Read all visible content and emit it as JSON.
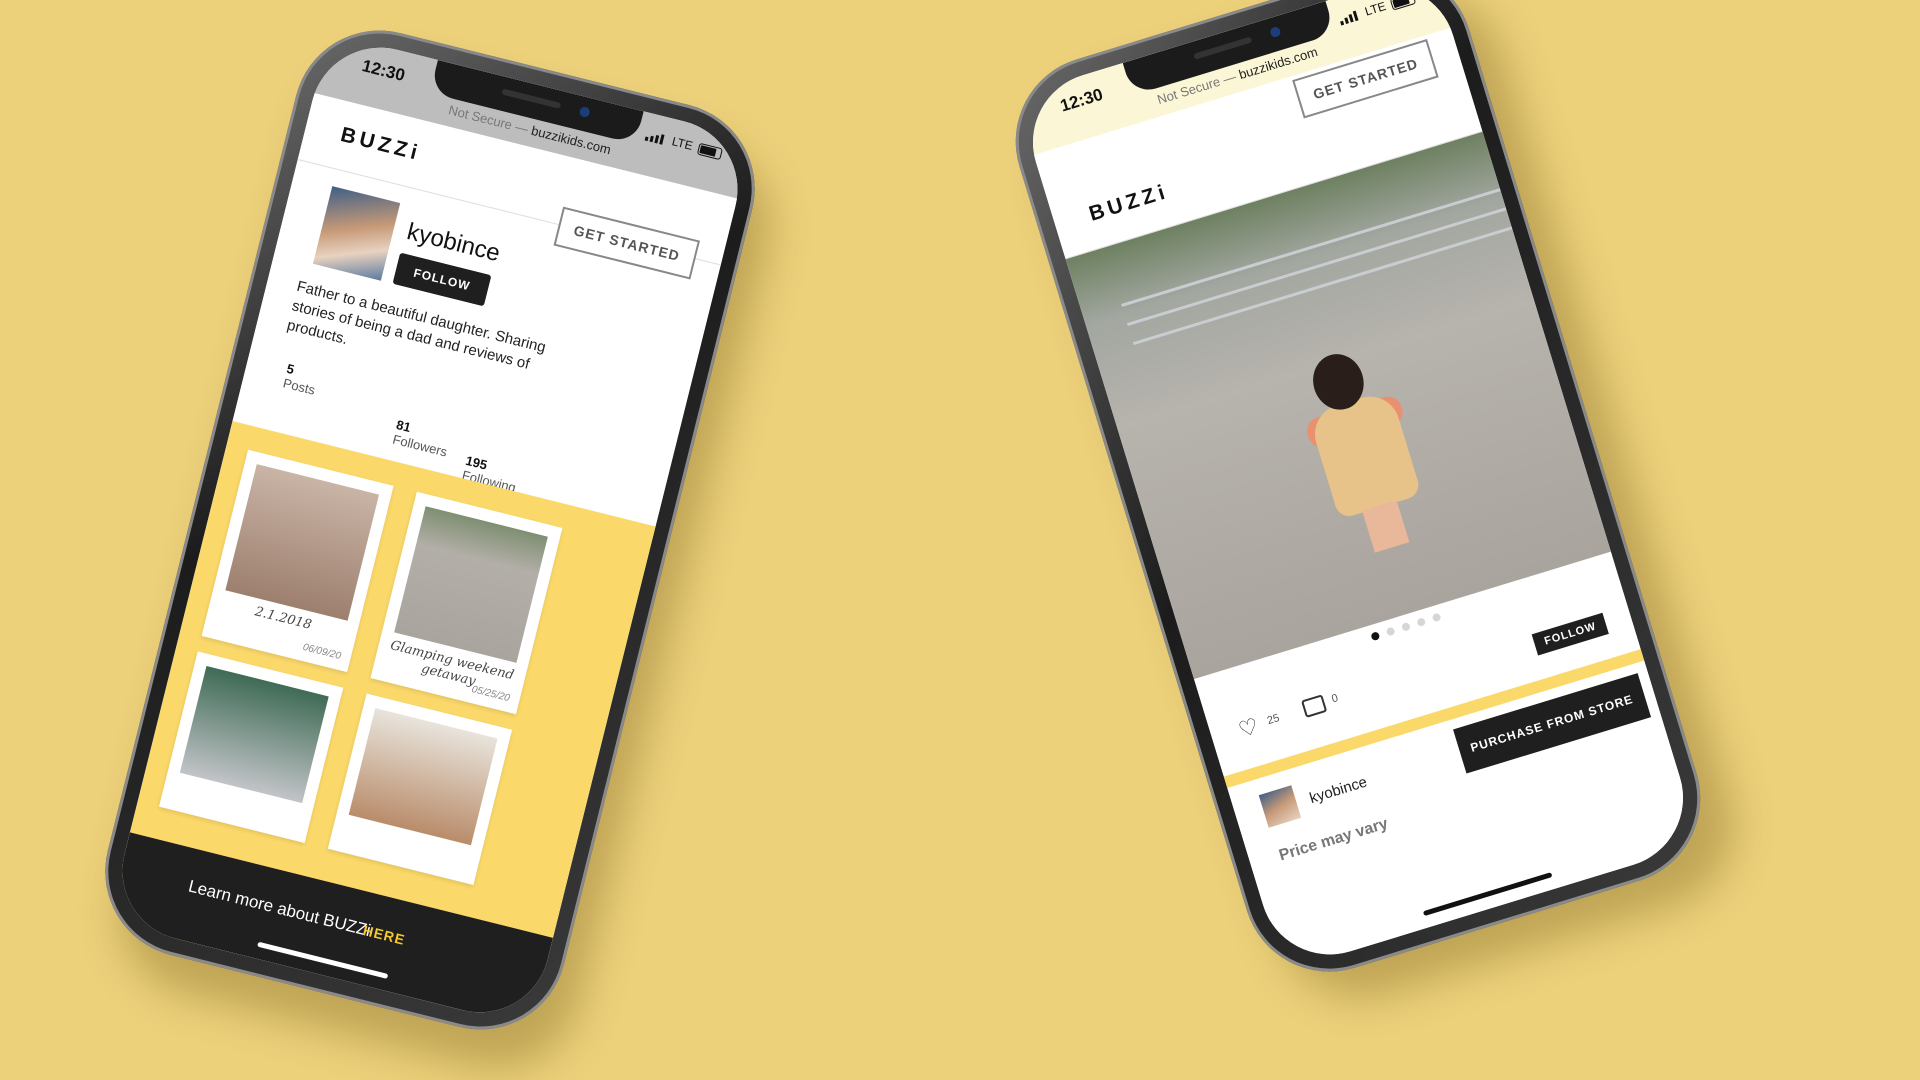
{
  "status": {
    "time": "12:30",
    "network": "LTE"
  },
  "browser": {
    "security": "Not Secure —",
    "domain": "buzzikids.com"
  },
  "brand": {
    "logo": "BUZZi",
    "accent_color": "#fad86a",
    "background_color": "#ecd07a"
  },
  "header": {
    "cta_label": "GET STARTED"
  },
  "profile": {
    "username": "kyobince",
    "follow_label": "FOLLOW",
    "bio": "Father to a beautiful daughter. Sharing stories of being a dad and reviews of products.",
    "stats": [
      {
        "value": "5",
        "label": "Posts"
      },
      {
        "value": "81",
        "label": "Followers"
      },
      {
        "value": "195",
        "label": "Following"
      }
    ]
  },
  "posts": [
    {
      "caption": "2.1.2018",
      "date": "06/09/20"
    },
    {
      "caption": "Glamping weekend getaway",
      "date": "05/25/20"
    },
    {
      "caption": "",
      "date": ""
    },
    {
      "caption": "",
      "date": ""
    }
  ],
  "banner": {
    "text": "Learn more about BUZZi",
    "link_label": "HERE"
  },
  "post_detail": {
    "carousel_total": 5,
    "carousel_active": 1,
    "likes": "25",
    "comments": "0",
    "follow_label": "FOLLOW",
    "author": "kyobince",
    "price_note": "Price may vary",
    "purchase_label": "PURCHASE FROM STORE"
  },
  "icons": [
    "heart-icon",
    "comment-icon",
    "signal-icon",
    "battery-icon"
  ]
}
